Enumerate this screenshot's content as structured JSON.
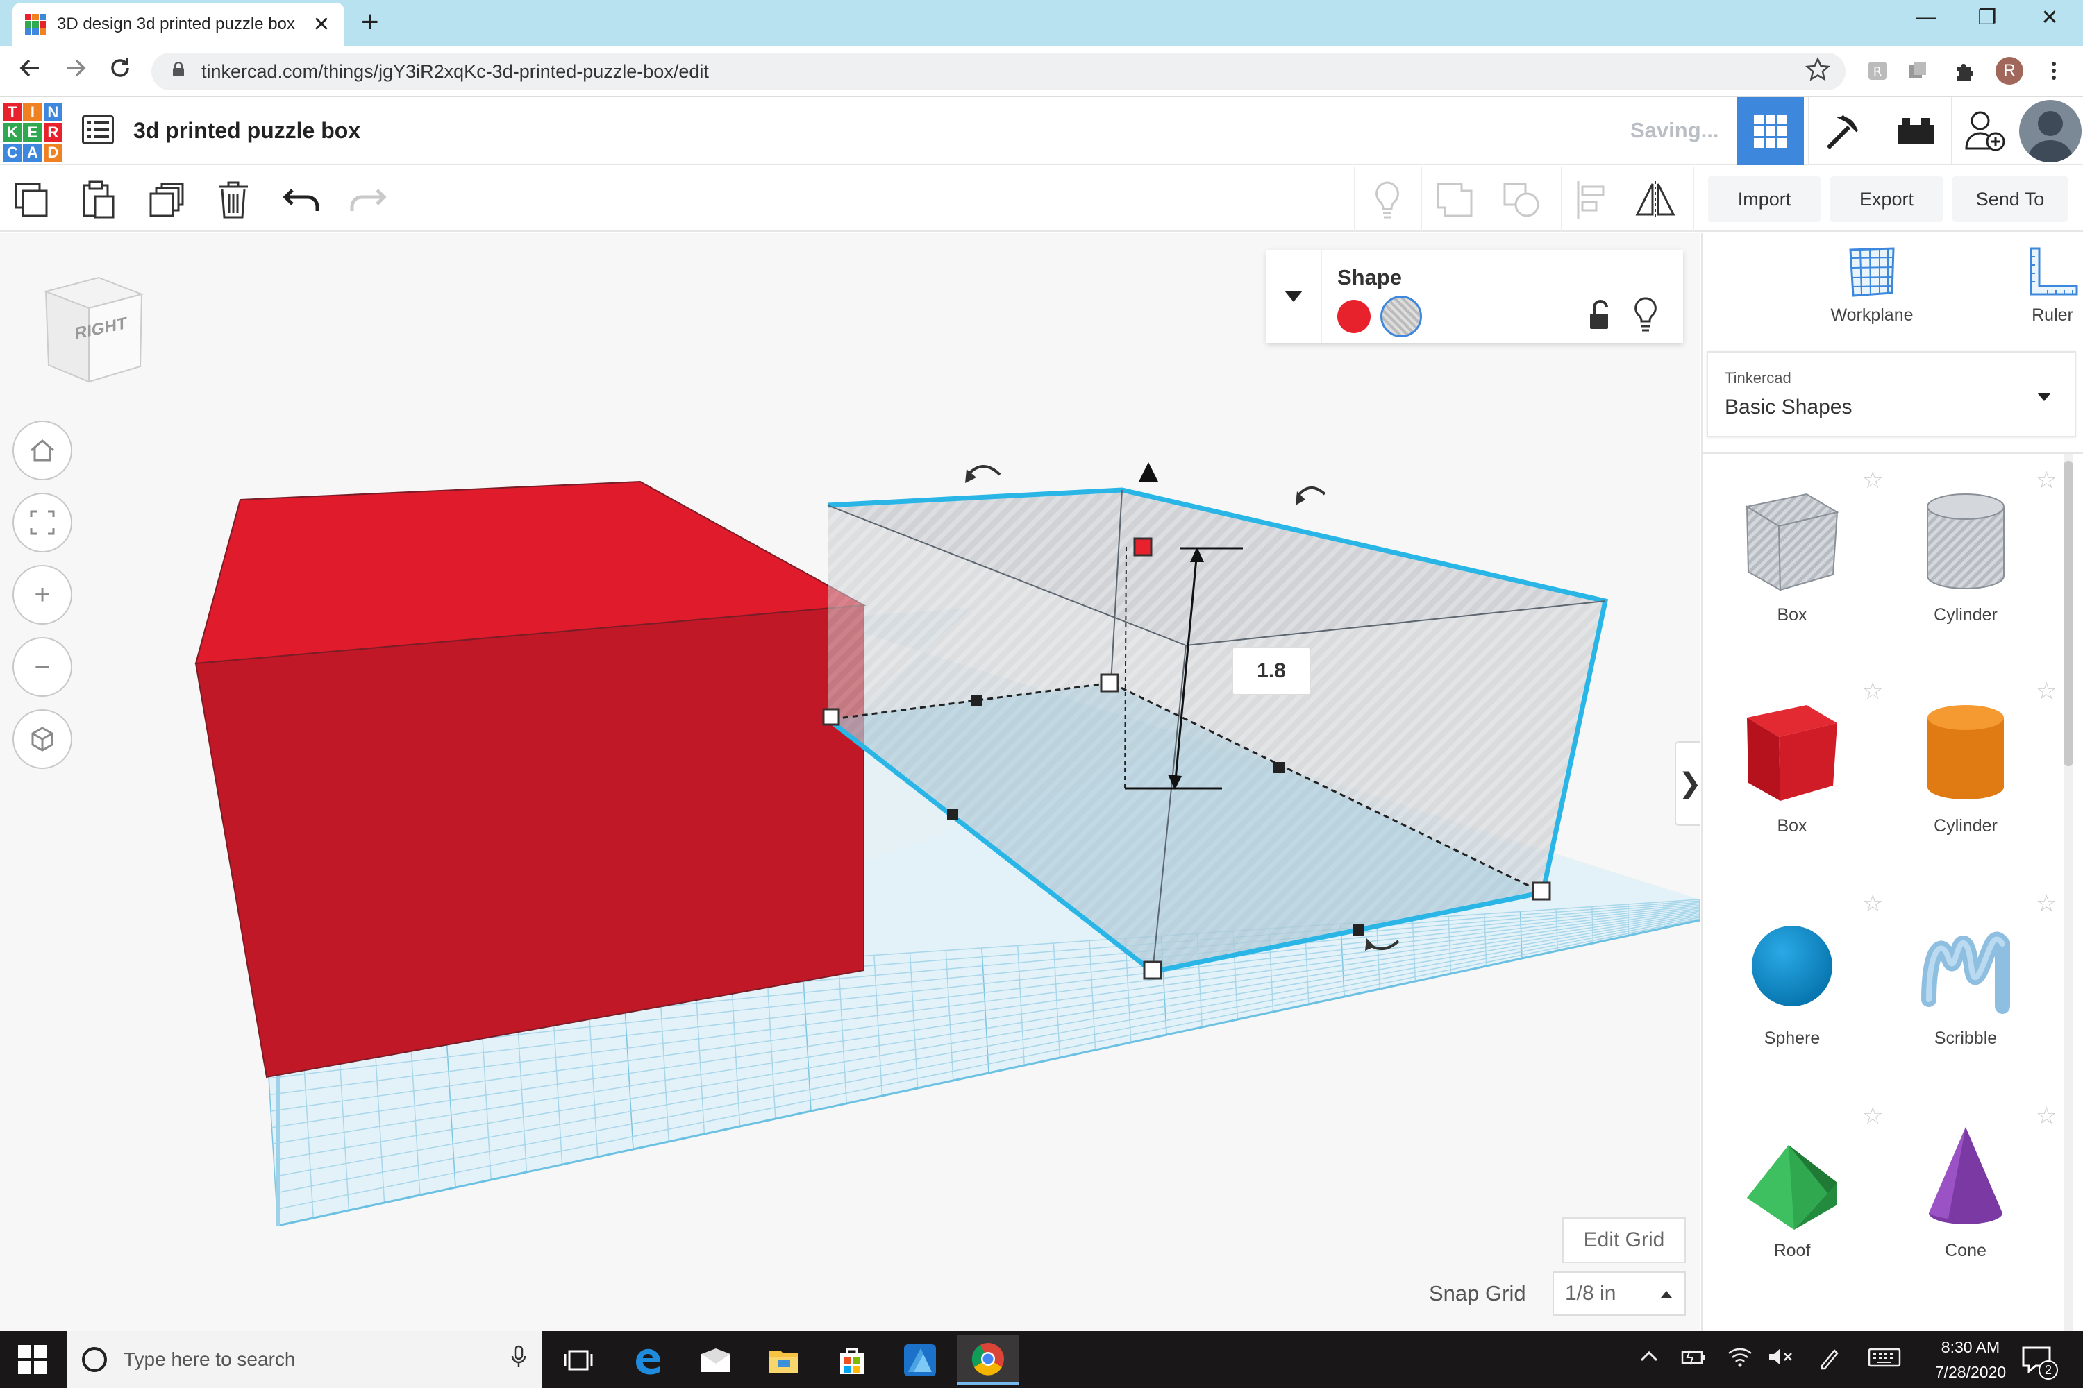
{
  "browser": {
    "tab_title": "3D design 3d printed puzzle box",
    "tab_close": "✕",
    "new_tab": "+",
    "url": "tinkercad.com/things/jgY3iR2xqKc-3d-printed-puzzle-box/edit",
    "profile_initial": "R",
    "window_minimize": "—",
    "window_restore": "❐",
    "window_close": "✕",
    "icons": [
      "back-arrow-icon",
      "forward-arrow-icon",
      "reload-icon",
      "lock-icon",
      "bookmark-star-icon",
      "extension-icon",
      "puzzle-extension-icon",
      "more-vertical-icon"
    ]
  },
  "app": {
    "logo_letters": [
      "T",
      "I",
      "N",
      "K",
      "E",
      "R",
      "C",
      "A",
      "D"
    ],
    "logo_colors": [
      "#e8222d",
      "#f08122",
      "#3d88dc",
      "#2fa84f",
      "#2fa84f",
      "#e8222d",
      "#3d88dc",
      "#3d88dc",
      "#f08122"
    ],
    "design_title": "3d printed puzzle box",
    "save_status": "Saving...",
    "accent_color": "#3d88dc"
  },
  "toolbar": {
    "import_label": "Import",
    "export_label": "Export",
    "send_to_label": "Send To",
    "tools": [
      "copy-icon",
      "paste-icon",
      "duplicate-icon",
      "delete-icon",
      "undo-icon",
      "redo-icon",
      "lightbulb-icon",
      "group-icon",
      "ungroup-icon",
      "align-icon",
      "mirror-icon"
    ]
  },
  "workspace": {
    "view_cube_label": "RIGHT",
    "view_controls": [
      "home-icon",
      "fit-icon",
      "zoom-in-icon",
      "zoom-out-icon",
      "perspective-icon"
    ],
    "zoom_in": "+",
    "zoom_out": "−",
    "dimension_value": "1.8",
    "collapse_chevron": "❯",
    "edit_grid_label": "Edit Grid",
    "snap_grid_label": "Snap Grid",
    "snap_grid_value": "1/8 in",
    "shape_panel": {
      "title": "Shape",
      "solid_color": "#e8222d",
      "hole_selected": true
    },
    "scene_colors": {
      "red_box_front": "#c01826",
      "red_box_top": "#e01b2b",
      "selection_outline": "#29b6e6",
      "grid_line": "#9fd3e8"
    }
  },
  "right_panel": {
    "workplane_label": "Workplane",
    "ruler_label": "Ruler",
    "category_source": "Tinkercad",
    "category_name": "Basic Shapes",
    "shapes": [
      {
        "label": "Box",
        "icon": "hole-box-icon"
      },
      {
        "label": "Cylinder",
        "icon": "hole-cylinder-icon"
      },
      {
        "label": "Box",
        "icon": "red-box-icon"
      },
      {
        "label": "Cylinder",
        "icon": "orange-cylinder-icon"
      },
      {
        "label": "Sphere",
        "icon": "sphere-icon"
      },
      {
        "label": "Scribble",
        "icon": "scribble-icon"
      },
      {
        "label": "Roof",
        "icon": "roof-icon"
      },
      {
        "label": "Cone",
        "icon": "cone-icon"
      }
    ],
    "star": "☆"
  },
  "taskbar": {
    "search_placeholder": "Type here to search",
    "time": "8:30 AM",
    "date": "7/28/2020",
    "notification_count": "2",
    "apps": [
      "task-view-icon",
      "edge-icon",
      "mail-icon",
      "file-explorer-icon",
      "store-icon",
      "affinity-icon",
      "chrome-icon"
    ]
  }
}
